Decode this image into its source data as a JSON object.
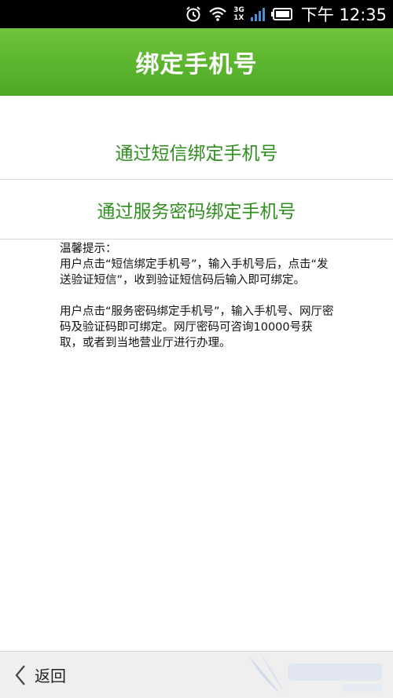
{
  "status_bar": {
    "network_top": "3G",
    "network_bottom": "1X",
    "time": "下午 12:35"
  },
  "header": {
    "title": "绑定手机号"
  },
  "options": [
    {
      "label": "通过短信绑定手机号"
    },
    {
      "label": "通过服务密码绑定手机号"
    }
  ],
  "tips": {
    "heading": "温馨提示：",
    "paragraph1": "用户点击“短信绑定手机号”，输入手机号后，点击“发送验证短信”，收到验证短信码后输入即可绑定。",
    "paragraph2": "用户点击“服务密码绑定手机号”，输入手机号、网厅密码及验证码即可绑定。网厅密码可咨询10000号获取，或者到当地营业厅进行办理。"
  },
  "bottom_bar": {
    "back_label": "返回"
  },
  "colors": {
    "header_green": "#5ab52f",
    "option_text_green": "#2f8f1e"
  }
}
